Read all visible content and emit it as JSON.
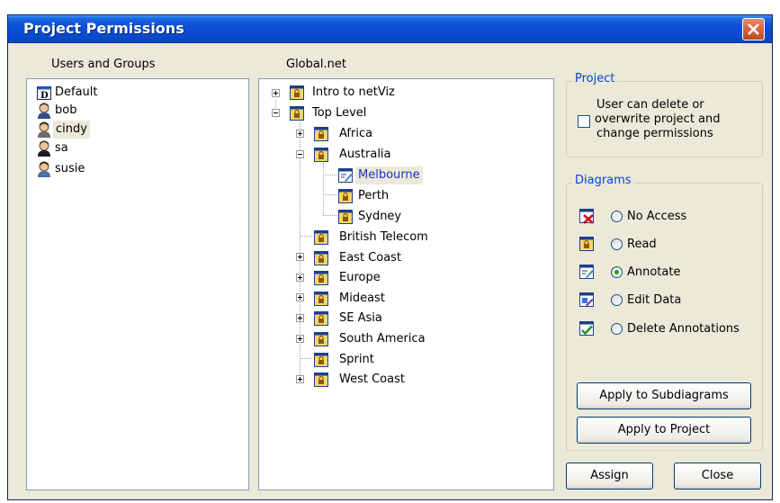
{
  "window": {
    "title": "Project Permissions"
  },
  "users": {
    "header": "Users and Groups",
    "items": [
      {
        "label": "Default",
        "icon": "group-icon"
      },
      {
        "label": "bob",
        "icon": "user-icon"
      },
      {
        "label": "cindy",
        "icon": "user-icon",
        "selected": true
      },
      {
        "label": "sa",
        "icon": "user-icon"
      },
      {
        "label": "susie",
        "icon": "user-icon"
      }
    ]
  },
  "tree": {
    "header": "Global.net",
    "nodes": [
      {
        "label": "Intro to netViz"
      },
      {
        "label": "Top Level"
      },
      {
        "label": "Africa"
      },
      {
        "label": "Australia"
      },
      {
        "label": "Melbourne",
        "selected": true
      },
      {
        "label": "Perth"
      },
      {
        "label": "Sydney"
      },
      {
        "label": "British Telecom"
      },
      {
        "label": "East Coast"
      },
      {
        "label": "Europe"
      },
      {
        "label": "Mideast"
      },
      {
        "label": "SE Asia"
      },
      {
        "label": "South America"
      },
      {
        "label": "Sprint"
      },
      {
        "label": "West Coast"
      }
    ]
  },
  "project": {
    "title": "Project",
    "checkbox_label_line1": "User can delete or",
    "checkbox_label_line2": "overwrite project and",
    "checkbox_label_line3": "change permissions",
    "checked": false
  },
  "diagrams": {
    "title": "Diagrams",
    "options": [
      {
        "label": "No Access",
        "icon": "no-access-icon"
      },
      {
        "label": "Read",
        "icon": "read-lock-icon"
      },
      {
        "label": "Annotate",
        "icon": "annotate-icon"
      },
      {
        "label": "Edit Data",
        "icon": "edit-data-icon"
      },
      {
        "label": "Delete Annotations",
        "icon": "delete-annotations-icon"
      }
    ],
    "selected": "Annotate",
    "apply_subdiagrams": "Apply to Subdiagrams",
    "apply_project": "Apply to Project"
  },
  "buttons": {
    "assign": "Assign",
    "close": "Close"
  },
  "colors": {
    "title_bar": "#0a4fd6",
    "selection_text": "#1a2fd0",
    "group_title": "#0046d5"
  }
}
